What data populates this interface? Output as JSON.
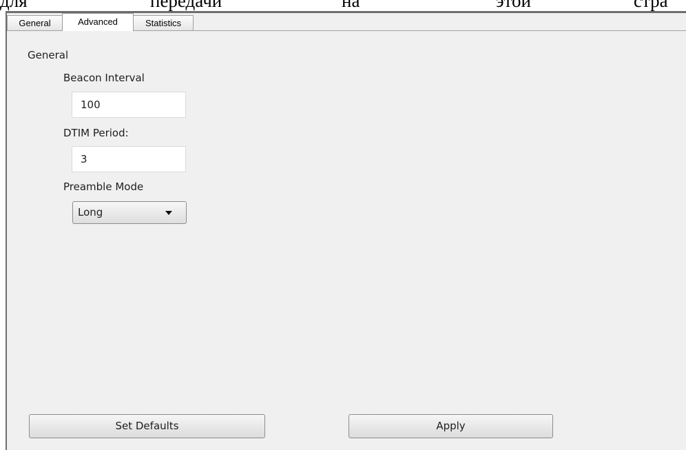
{
  "document": {
    "words": [
      "для",
      "передачи",
      "на",
      "этой",
      "стра"
    ]
  },
  "tabs": [
    {
      "label": "General",
      "active": false
    },
    {
      "label": "Advanced",
      "active": true
    },
    {
      "label": "Statistics",
      "active": false
    }
  ],
  "panel": {
    "section_title": "General",
    "beacon_interval": {
      "label": "Beacon Interval",
      "value": "100"
    },
    "dtim_period": {
      "label": "DTIM Period:",
      "value": "3"
    },
    "preamble_mode": {
      "label": "Preamble Mode",
      "selected": "Long"
    }
  },
  "buttons": {
    "set_defaults": "Set Defaults",
    "apply": "Apply"
  }
}
